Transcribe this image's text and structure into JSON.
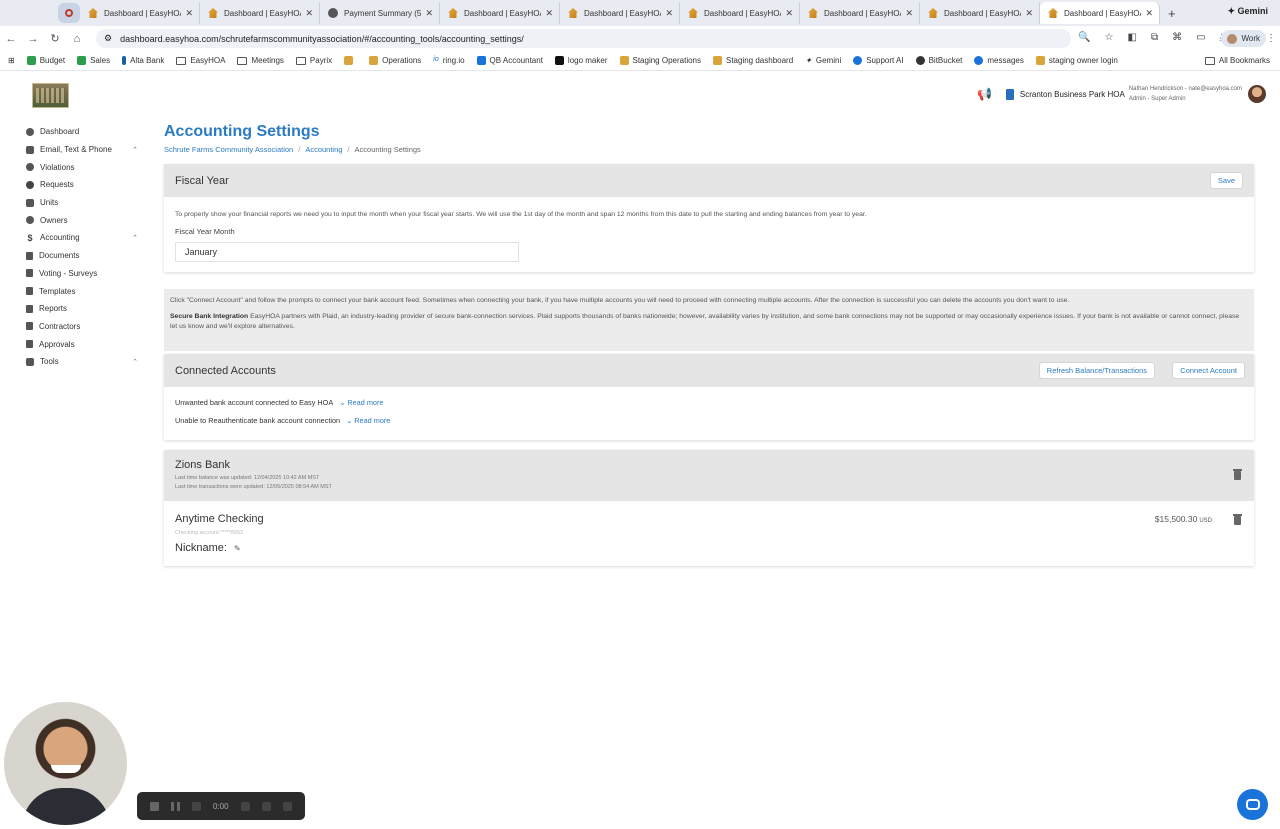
{
  "browser": {
    "tabs": [
      {
        "title": "Dashboard | EasyHOA",
        "icon": "easyhoa-icon"
      },
      {
        "title": "Dashboard | EasyHOA",
        "icon": "easyhoa-icon"
      },
      {
        "title": "Payment Summary (5",
        "icon": "payment-icon"
      },
      {
        "title": "Dashboard | EasyHOA",
        "icon": "easyhoa-icon"
      },
      {
        "title": "Dashboard | EasyHOA",
        "icon": "easyhoa-icon"
      },
      {
        "title": "Dashboard | EasyHOA",
        "icon": "easyhoa-icon"
      },
      {
        "title": "Dashboard | EasyHOA",
        "icon": "easyhoa-icon"
      },
      {
        "title": "Dashboard | EasyHOA",
        "icon": "easyhoa-icon"
      },
      {
        "title": "Dashboard | EasyHOA",
        "icon": "easyhoa-icon",
        "active": true
      }
    ],
    "gemini": "Gemini",
    "url": "dashboard.easyhoa.com/schrutefarmscommunityassociation/#/accounting_tools/accounting_settings/",
    "profile": "Work",
    "bookmarks": [
      "Budget",
      "Sales",
      "Alta Bank",
      "EasyHOA",
      "Meetings",
      "Payrix",
      "Operations",
      "ring.io",
      "QB Accountant",
      "logo maker",
      "Staging Operations",
      "Staging dashboard",
      "Gemini",
      "Support AI",
      "BitBucket",
      "messages",
      "staging owner login"
    ],
    "all_bookmarks": "All Bookmarks"
  },
  "header": {
    "association": "Scranton Business Park HOA",
    "user_line": "Nathan Hendrickson - nate@easyhoa.com",
    "role": "Admin - Super Admin"
  },
  "sidebar": {
    "items": [
      {
        "label": "Dashboard"
      },
      {
        "label": "Email, Text & Phone"
      },
      {
        "label": "Violations"
      },
      {
        "label": "Requests"
      },
      {
        "label": "Units"
      },
      {
        "label": "Owners"
      },
      {
        "label": "Accounting"
      },
      {
        "label": "Documents"
      },
      {
        "label": "Voting - Surveys"
      },
      {
        "label": "Templates"
      },
      {
        "label": "Reports"
      },
      {
        "label": "Contractors"
      },
      {
        "label": "Approvals"
      },
      {
        "label": "Tools"
      }
    ]
  },
  "page": {
    "title": "Accounting Settings",
    "breadcrumb": [
      "Schrute Farms Community Association",
      "Accounting",
      "Accounting Settings"
    ]
  },
  "fiscal": {
    "title": "Fiscal Year",
    "save": "Save",
    "help": "To properly show your financial reports we need you to input the month when your fiscal year starts. We will use the 1st day of the month and span 12 months from this date to pull the starting and ending balances from year to year.",
    "label": "Fiscal Year Month",
    "value": "January"
  },
  "info": {
    "line1": "Click \"Connect Account\" and follow the prompts to connect your bank account feed. Sometimes when connecting your bank, if you have multiple accounts you will need to proceed with connecting multiple accounts. After the connection is successful you can delete the accounts you don't want to use.",
    "bold": "Secure Bank Integration",
    "line2": "EasyHOA partners with Plaid, an industry-leading provider of secure bank-connection services. Plaid supports thousands of banks nationwide; however, availability varies by institution, and some bank connections may not be supported or may occasionally experience issues. If your bank is not available or cannot connect, please let us know and we'll explore alternatives."
  },
  "connected": {
    "title": "Connected Accounts",
    "refresh": "Refresh Balance/Transactions",
    "connect": "Connect Account",
    "faq1": "Unwanted bank account connected to Easy HOA",
    "faq2": "Unable to Reauthenticate bank account connection",
    "read_more": "Read more"
  },
  "bank": {
    "name": "Zions Bank",
    "balance_updated": "Last time balance was updated: 12/04/2025 10:42 AM MST",
    "tx_updated": "Last time transactions were updated: 12/05/2025 08:54 AM MST",
    "account": "Anytime Checking",
    "account_sub": "Checking account *****8952",
    "nickname": "Nickname:",
    "amount": "$15,500.30",
    "currency": "USD"
  },
  "recorder": {
    "time": "0:00"
  },
  "colors": {
    "accent": "#2b7bc4",
    "chat": "#1a73d8"
  }
}
